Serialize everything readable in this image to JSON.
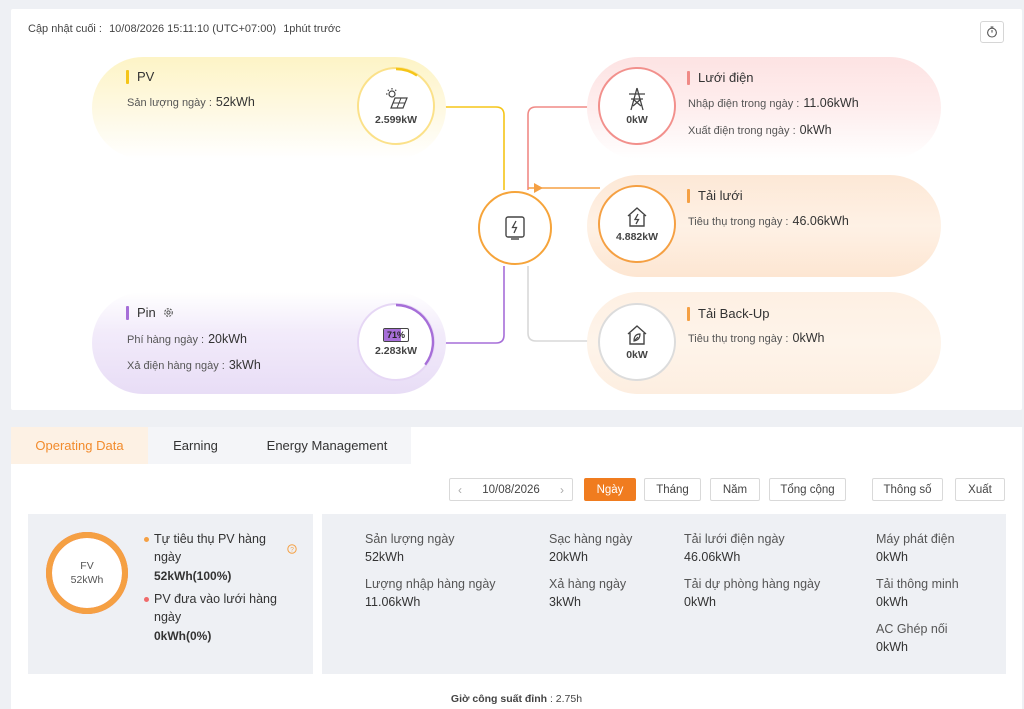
{
  "header": {
    "last_update_label": "Cập nhật cuối :",
    "last_update_value": "10/08/2026 15:11:10 (UTC+07:00)",
    "ago": "1phút trước"
  },
  "pv": {
    "title": "PV",
    "daily_label": "Sản lượng ngày :",
    "daily_value": "52kWh",
    "power": "2.599kW",
    "color": "#f5c518"
  },
  "battery": {
    "title": "Pin",
    "charge_label": "Phí hàng ngày :",
    "charge_value": "20kWh",
    "discharge_label": "Xả điện hàng ngày :",
    "discharge_value": "3kWh",
    "soc": "71%",
    "soc_fraction": 0.71,
    "power": "2.283kW",
    "color": "#a66ed8"
  },
  "grid": {
    "title": "Lưới điện",
    "import_label": "Nhập điện trong ngày :",
    "import_value": "11.06kWh",
    "export_label": "Xuất điện trong ngày :",
    "export_value": "0kWh",
    "power": "0kW",
    "color": "#f08a86"
  },
  "load": {
    "title": "Tải lưới",
    "consume_label": "Tiêu thụ trong ngày :",
    "consume_value": "46.06kWh",
    "power": "4.882kW",
    "color": "#f5a043"
  },
  "backup": {
    "title": "Tải Back-Up",
    "consume_label": "Tiêu thụ trong ngày :",
    "consume_value": "0kWh",
    "power": "0kW",
    "color": "#f5a043"
  },
  "tabs": [
    {
      "label": "Operating Data"
    },
    {
      "label": "Earning"
    },
    {
      "label": "Energy Management"
    }
  ],
  "toolbar": {
    "date": "10/08/2026",
    "day": "Ngày",
    "month": "Tháng",
    "year": "Năm",
    "total": "Tổng cộng",
    "params": "Thông số",
    "export": "Xuất"
  },
  "self_use": {
    "ring_label": "FV",
    "ring_value": "52kWh",
    "self_label": "Tự tiêu thụ PV hàng ngày",
    "self_value": "52kWh(100%)",
    "self_fraction": 1.0,
    "feed_label": "PV đưa vào lưới hàng ngày",
    "feed_value": "0kWh(0%)",
    "self_color": "#f5a043",
    "feed_color": "#f06a6a"
  },
  "stats": [
    {
      "label": "Sản lượng ngày",
      "value": "52kWh"
    },
    {
      "label": "Sạc hàng ngày",
      "value": "20kWh"
    },
    {
      "label": "Tải lưới điện ngày",
      "value": "46.06kWh"
    },
    {
      "label": "Máy phát điện",
      "value": "0kWh"
    },
    {
      "label": "Lượng nhập hàng ngày",
      "value": "11.06kWh"
    },
    {
      "label": "Xả hàng ngày",
      "value": "3kWh"
    },
    {
      "label": "Tải dự phòng hàng ngày",
      "value": "0kWh"
    },
    {
      "label": "Tải thông minh",
      "value": "0kWh"
    },
    {
      "label": "AC Ghép nối",
      "value": "0kWh"
    }
  ],
  "peak": {
    "label": "Giờ công suất đỉnh",
    "value": ": 2.75h"
  }
}
